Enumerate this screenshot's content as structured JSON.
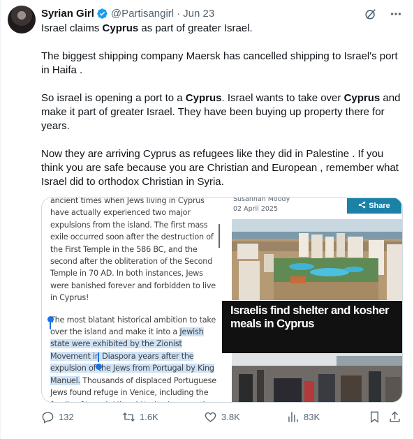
{
  "tweet": {
    "author_name": "Syrian Girl",
    "handle": "@Partisangirl",
    "separator": "·",
    "date": "Jun 23",
    "para1_a": "Israel claims ",
    "para1_bold": "Cyprus",
    "para1_b": " as part of greater Israel.",
    "para2": "The biggest shipping company Maersk has cancelled shipping to Israel's port in Haifa .",
    "para3_a": "So israel is opening a port to a ",
    "para3_bold1": "Cyprus",
    "para3_b": ". Israel wants to take over ",
    "para3_bold2": "Cyprus",
    "para3_c": " and make it part of greater Israel. They have been buying up property there for years.",
    "para4": "Now they are arriving Cyprus as refugees like they did in Palestine . If you think you are safe because you are Christian and European , remember what Israel did to orthodox Christian in Syria."
  },
  "media": {
    "article_p1": "ancient times when Jews living in Cyprus have actually experienced two major expulsions from the island. The first mass exile occurred soon after the destruction of the First Temple in the 586 BC, and the second after the obliteration of the Second Temple in 70 AD. In both instances, Jews were banished forever and forbidden to live in Cyprus!",
    "article_p2_a": "The most blatant historical ambition to take over the island and make it into a ",
    "article_p2_hl": "Jewish state were exhibited by the Zionist Movement in Diaspora years after the expulsion of the Jews from Portugal by King Manuel.",
    "article_p2_b": " Thousands of displaced Portuguese Jews found refuge in Venice, including the family of Joseph Miquel Nasi, whose mother was a prominent socialite",
    "byline_author": "Susannah Moody",
    "byline_date": "02 April 2025",
    "share_label": "Share",
    "headline": "Israelis find shelter and kosher meals in Cyprus"
  },
  "actions": {
    "replies": "132",
    "reposts": "1.6K",
    "likes": "3.8K",
    "views": "83K"
  },
  "colors": {
    "accent": "#1d9bf0",
    "muted": "#536471",
    "highlight": "#cfe3f7",
    "share_button": "#1a82a6"
  },
  "icons": [
    "verified-badge-icon",
    "grok-icon",
    "more-icon",
    "reply-icon",
    "repost-icon",
    "like-icon",
    "views-icon",
    "bookmark-icon",
    "share-icon"
  ]
}
